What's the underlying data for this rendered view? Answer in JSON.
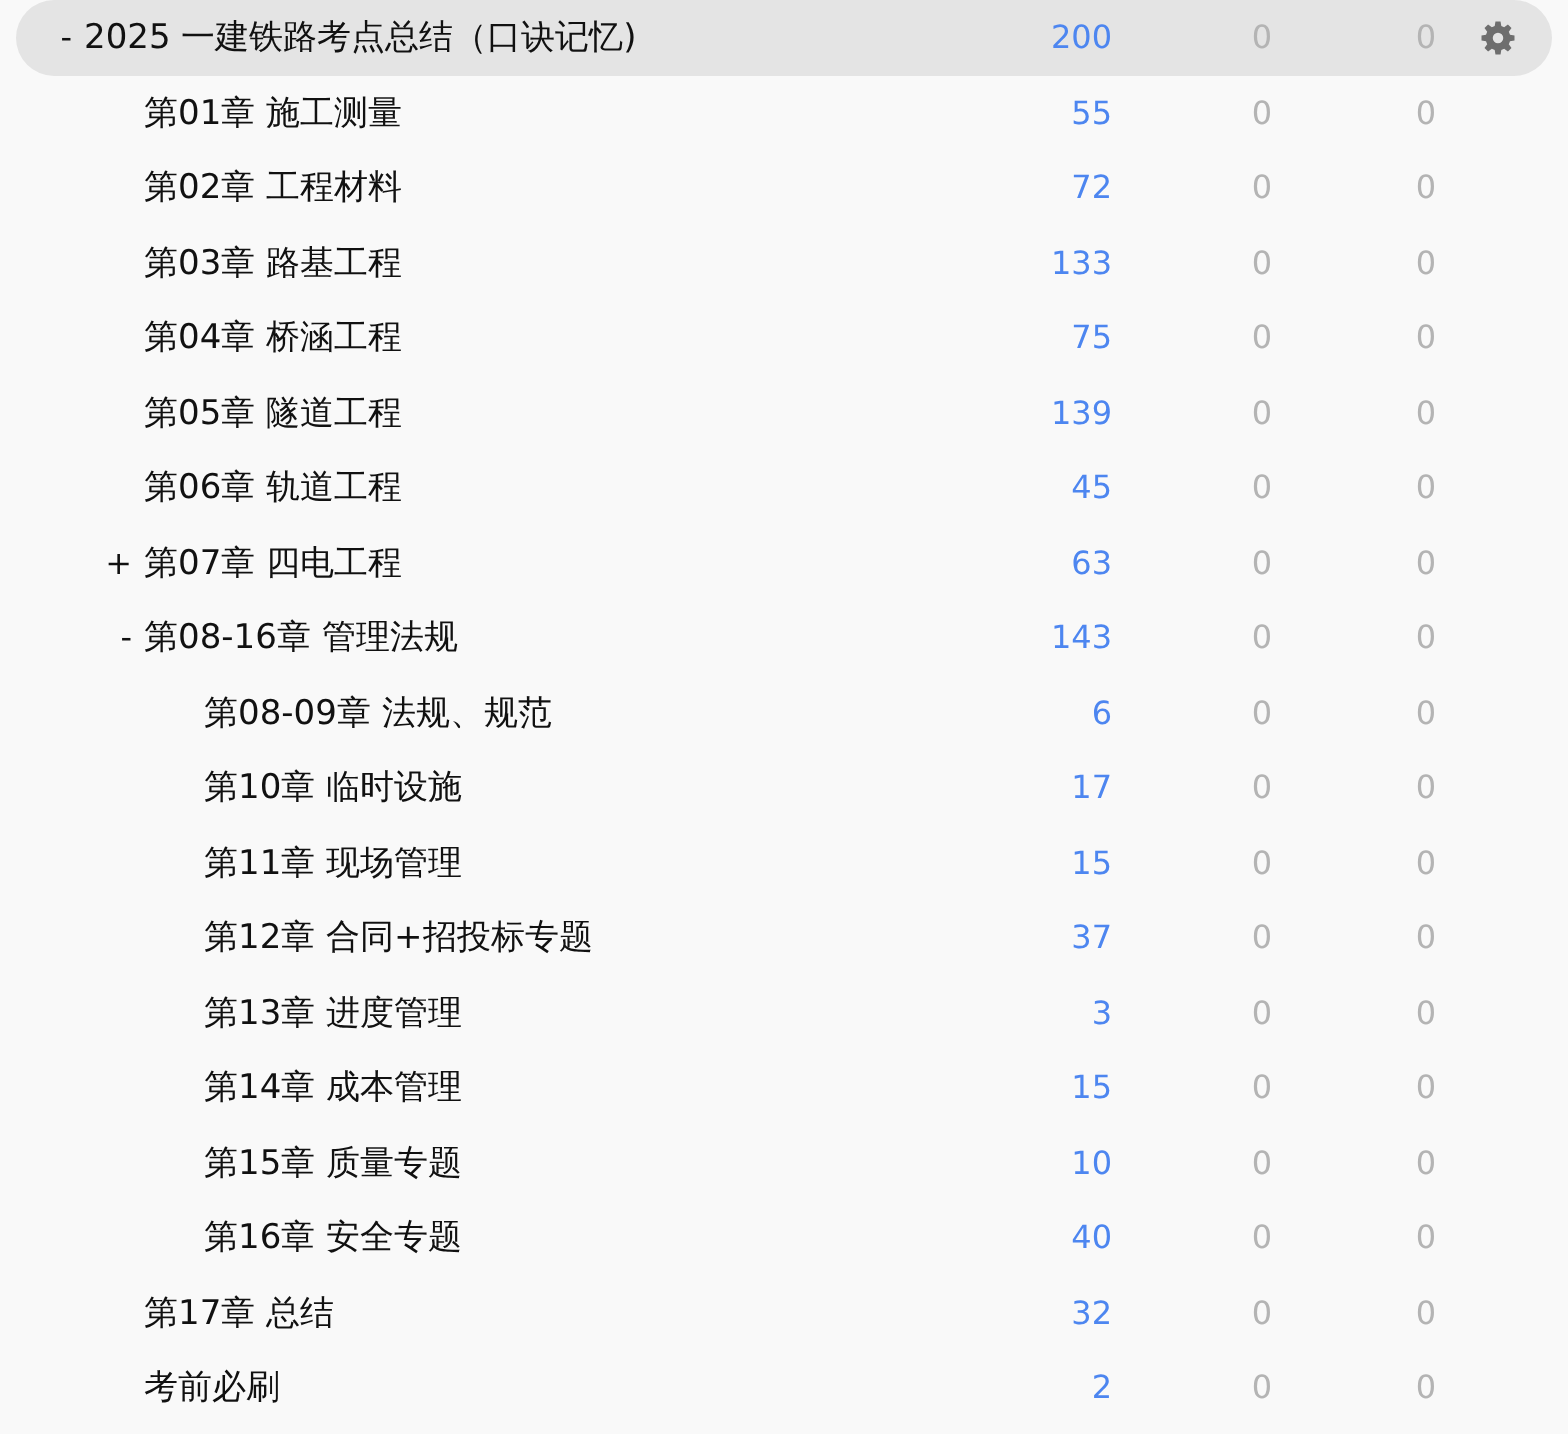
{
  "decks": [
    {
      "toggle": "-",
      "name": "2025 一建铁路考点总结（口诀记忆)",
      "new": "200",
      "learn": "0",
      "due": "0",
      "selected": true,
      "children": [
        {
          "name": "第01章 施工测量",
          "new": "55",
          "learn": "0",
          "due": "0",
          "selected": false
        },
        {
          "name": "第02章 工程材料",
          "new": "72",
          "learn": "0",
          "due": "0",
          "selected": false
        },
        {
          "name": "第03章 路基工程",
          "new": "133",
          "learn": "0",
          "due": "0",
          "selected": false
        },
        {
          "name": "第04章 桥涵工程",
          "new": "75",
          "learn": "0",
          "due": "0",
          "selected": false
        },
        {
          "name": "第05章 隧道工程",
          "new": "139",
          "learn": "0",
          "due": "0",
          "selected": false
        },
        {
          "name": "第06章 轨道工程",
          "new": "45",
          "learn": "0",
          "due": "0",
          "selected": false
        },
        {
          "toggle": "+",
          "name": "第07章 四电工程",
          "new": "63",
          "learn": "0",
          "due": "0",
          "selected": false
        },
        {
          "toggle": "-",
          "name": "第08-16章 管理法规",
          "new": "143",
          "learn": "0",
          "due": "0",
          "selected": false,
          "children": [
            {
              "name": "第08-09章 法规、规范",
              "new": "6",
              "learn": "0",
              "due": "0",
              "selected": false
            },
            {
              "name": "第10章 临时设施",
              "new": "17",
              "learn": "0",
              "due": "0",
              "selected": false
            },
            {
              "name": "第11章 现场管理",
              "new": "15",
              "learn": "0",
              "due": "0",
              "selected": false
            },
            {
              "name": "第12章 合同+招投标专题",
              "new": "37",
              "learn": "0",
              "due": "0",
              "selected": false
            },
            {
              "name": "第13章 进度管理",
              "new": "3",
              "learn": "0",
              "due": "0",
              "selected": false
            },
            {
              "name": "第14章 成本管理",
              "new": "15",
              "learn": "0",
              "due": "0",
              "selected": false
            },
            {
              "name": "第15章 质量专题",
              "new": "10",
              "learn": "0",
              "due": "0",
              "selected": false
            },
            {
              "name": "第16章 安全专题",
              "new": "40",
              "learn": "0",
              "due": "0",
              "selected": false
            }
          ]
        },
        {
          "name": "第17章 总结",
          "new": "32",
          "learn": "0",
          "due": "0",
          "selected": false
        },
        {
          "name": "考前必刷",
          "new": "2",
          "learn": "0",
          "due": "0",
          "selected": false
        }
      ]
    }
  ]
}
